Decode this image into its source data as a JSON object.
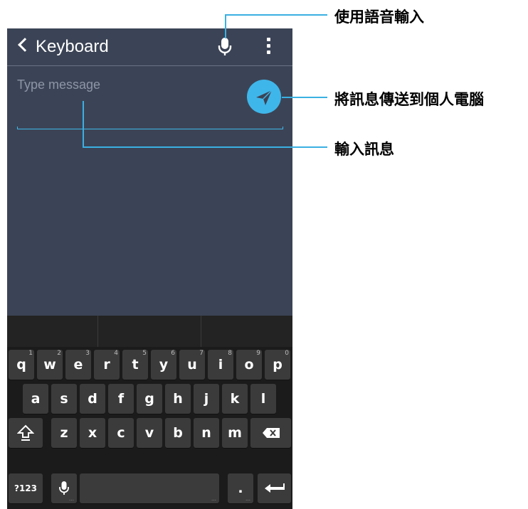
{
  "app_bar": {
    "back_label": "Keyboard"
  },
  "compose": {
    "placeholder": "Type message"
  },
  "keyboard": {
    "row1": [
      {
        "label": "q",
        "hint": "1"
      },
      {
        "label": "w",
        "hint": "2"
      },
      {
        "label": "e",
        "hint": "3"
      },
      {
        "label": "r",
        "hint": "4"
      },
      {
        "label": "t",
        "hint": "5"
      },
      {
        "label": "y",
        "hint": "6"
      },
      {
        "label": "u",
        "hint": "7"
      },
      {
        "label": "i",
        "hint": "8"
      },
      {
        "label": "o",
        "hint": "9"
      },
      {
        "label": "p",
        "hint": "0"
      }
    ],
    "row2": [
      "a",
      "s",
      "d",
      "f",
      "g",
      "h",
      "j",
      "k",
      "l"
    ],
    "row3": [
      "z",
      "x",
      "c",
      "v",
      "b",
      "n",
      "m"
    ],
    "symbols_label": "?123",
    "period_label": "."
  },
  "callouts": {
    "voice_input": "使用語音輸入",
    "send_to_pc": "將訊息傳送到個人電腦",
    "enter_message": "輸入訊息"
  },
  "colors": {
    "accent": "#3fb6ea",
    "screen_bg": "#3b4456",
    "keyboard_bg": "#1b1b1b",
    "key_bg": "#3b3b3b"
  }
}
